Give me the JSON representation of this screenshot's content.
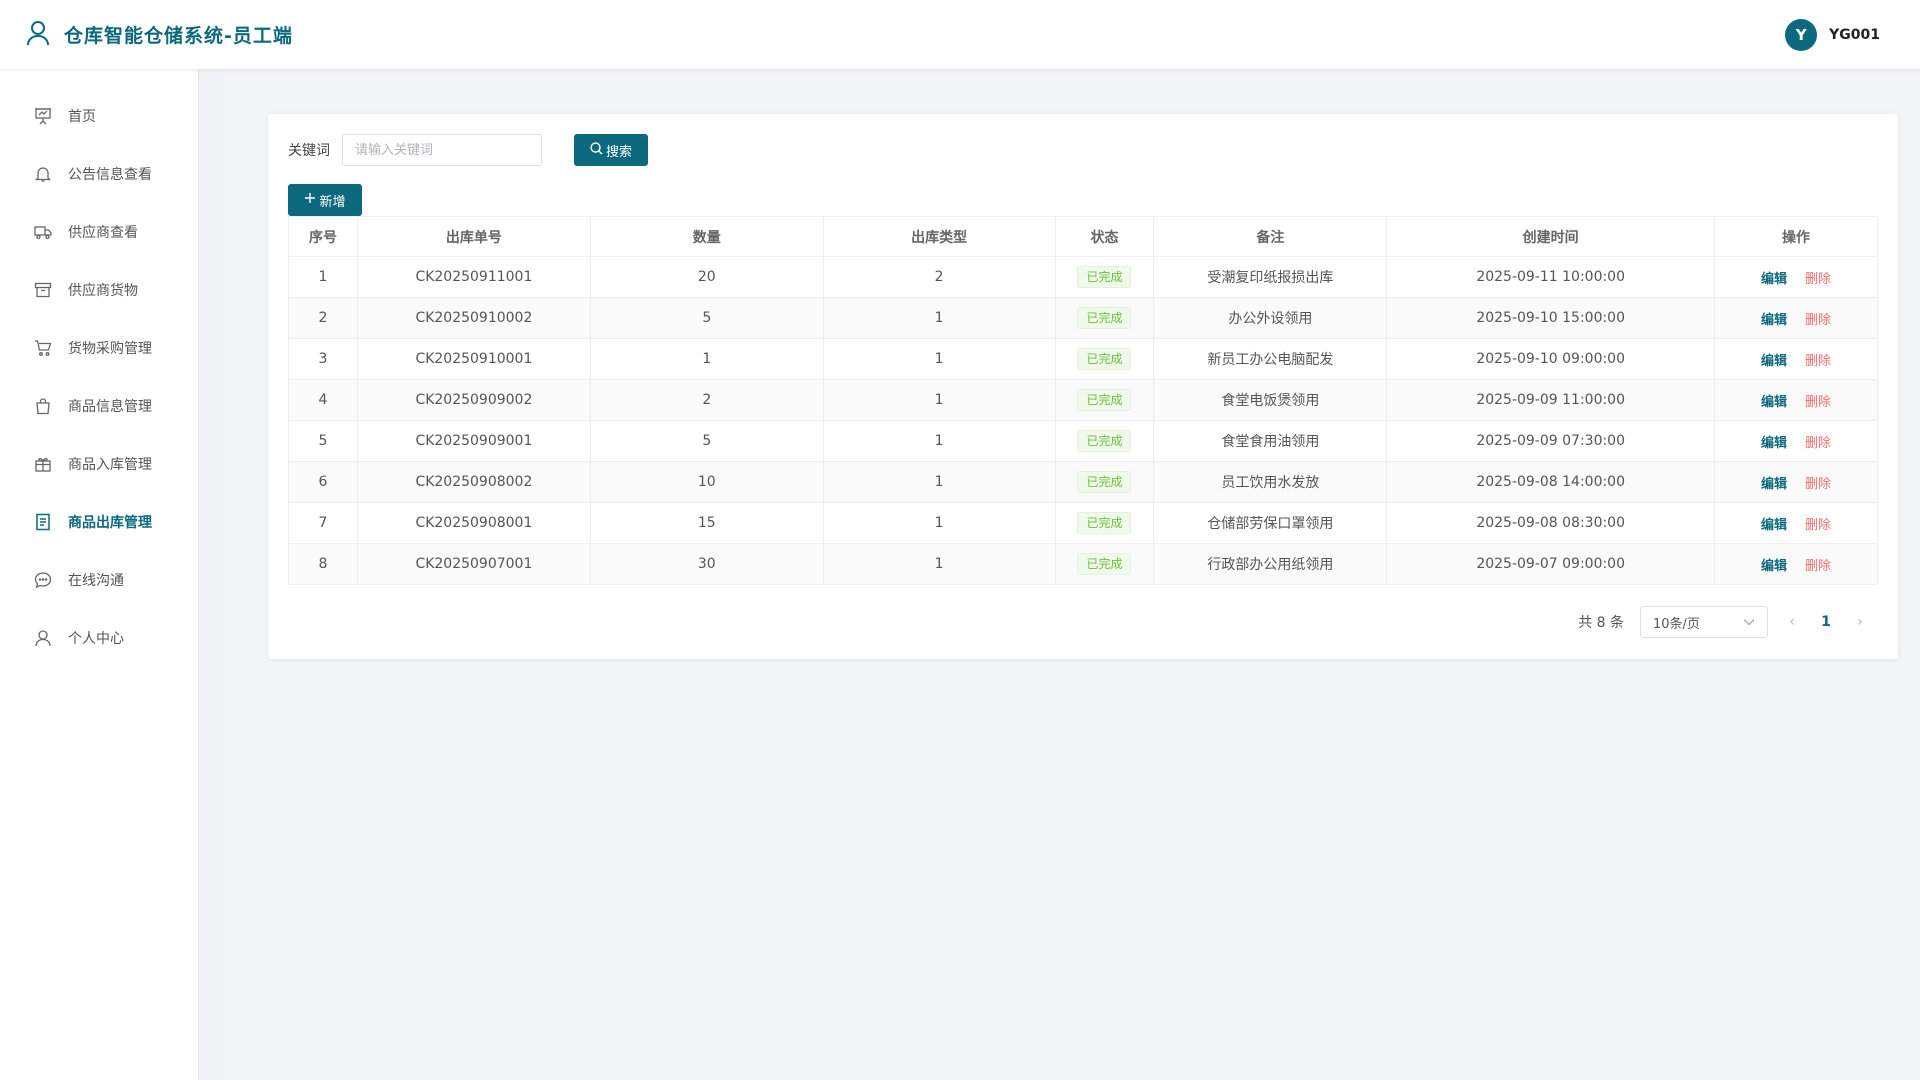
{
  "header": {
    "title": "仓库智能仓储系统-员工端",
    "avatar_letter": "Y",
    "username": "YG001"
  },
  "sidebar": {
    "items": [
      {
        "label": "首页",
        "icon": "presentation-icon"
      },
      {
        "label": "公告信息查看",
        "icon": "bell-icon"
      },
      {
        "label": "供应商查看",
        "icon": "truck-icon"
      },
      {
        "label": "供应商货物",
        "icon": "box-icon"
      },
      {
        "label": "货物采购管理",
        "icon": "cart-icon"
      },
      {
        "label": "商品信息管理",
        "icon": "bag-icon"
      },
      {
        "label": "商品入库管理",
        "icon": "gift-icon"
      },
      {
        "label": "商品出库管理",
        "icon": "document-icon"
      },
      {
        "label": "在线沟通",
        "icon": "chat-icon"
      },
      {
        "label": "个人中心",
        "icon": "user-icon"
      }
    ],
    "active_index": 7
  },
  "search": {
    "label": "关键词",
    "placeholder": "请输入关键词",
    "button_label": "搜索"
  },
  "toolbar": {
    "add_label": "新增"
  },
  "table": {
    "columns": [
      "序号",
      "出库单号",
      "数量",
      "出库类型",
      "状态",
      "备注",
      "创建时间",
      "操作"
    ],
    "rows": [
      {
        "index": "1",
        "order_no": "CK20250911001",
        "quantity": "20",
        "type": "2",
        "status": "已完成",
        "remark": "受潮复印纸报损出库",
        "created": "2025-09-11 10:00:00"
      },
      {
        "index": "2",
        "order_no": "CK20250910002",
        "quantity": "5",
        "type": "1",
        "status": "已完成",
        "remark": "办公外设领用",
        "created": "2025-09-10 15:00:00"
      },
      {
        "index": "3",
        "order_no": "CK20250910001",
        "quantity": "1",
        "type": "1",
        "status": "已完成",
        "remark": "新员工办公电脑配发",
        "created": "2025-09-10 09:00:00"
      },
      {
        "index": "4",
        "order_no": "CK20250909002",
        "quantity": "2",
        "type": "1",
        "status": "已完成",
        "remark": "食堂电饭煲领用",
        "created": "2025-09-09 11:00:00"
      },
      {
        "index": "5",
        "order_no": "CK20250909001",
        "quantity": "5",
        "type": "1",
        "status": "已完成",
        "remark": "食堂食用油领用",
        "created": "2025-09-09 07:30:00"
      },
      {
        "index": "6",
        "order_no": "CK20250908002",
        "quantity": "10",
        "type": "1",
        "status": "已完成",
        "remark": "员工饮用水发放",
        "created": "2025-09-08 14:00:00"
      },
      {
        "index": "7",
        "order_no": "CK20250908001",
        "quantity": "15",
        "type": "1",
        "status": "已完成",
        "remark": "仓储部劳保口罩领用",
        "created": "2025-09-08 08:30:00"
      },
      {
        "index": "8",
        "order_no": "CK20250907001",
        "quantity": "30",
        "type": "1",
        "status": "已完成",
        "remark": "行政部办公用纸领用",
        "created": "2025-09-07 09:00:00"
      }
    ],
    "edit_label": "编辑",
    "delete_label": "删除"
  },
  "pagination": {
    "total_text": "共 8 条",
    "page_size": "10条/页",
    "current_page": "1"
  },
  "colors": {
    "primary": "#0d6a7e",
    "danger": "#f56c6c",
    "success": "#67c23a"
  }
}
